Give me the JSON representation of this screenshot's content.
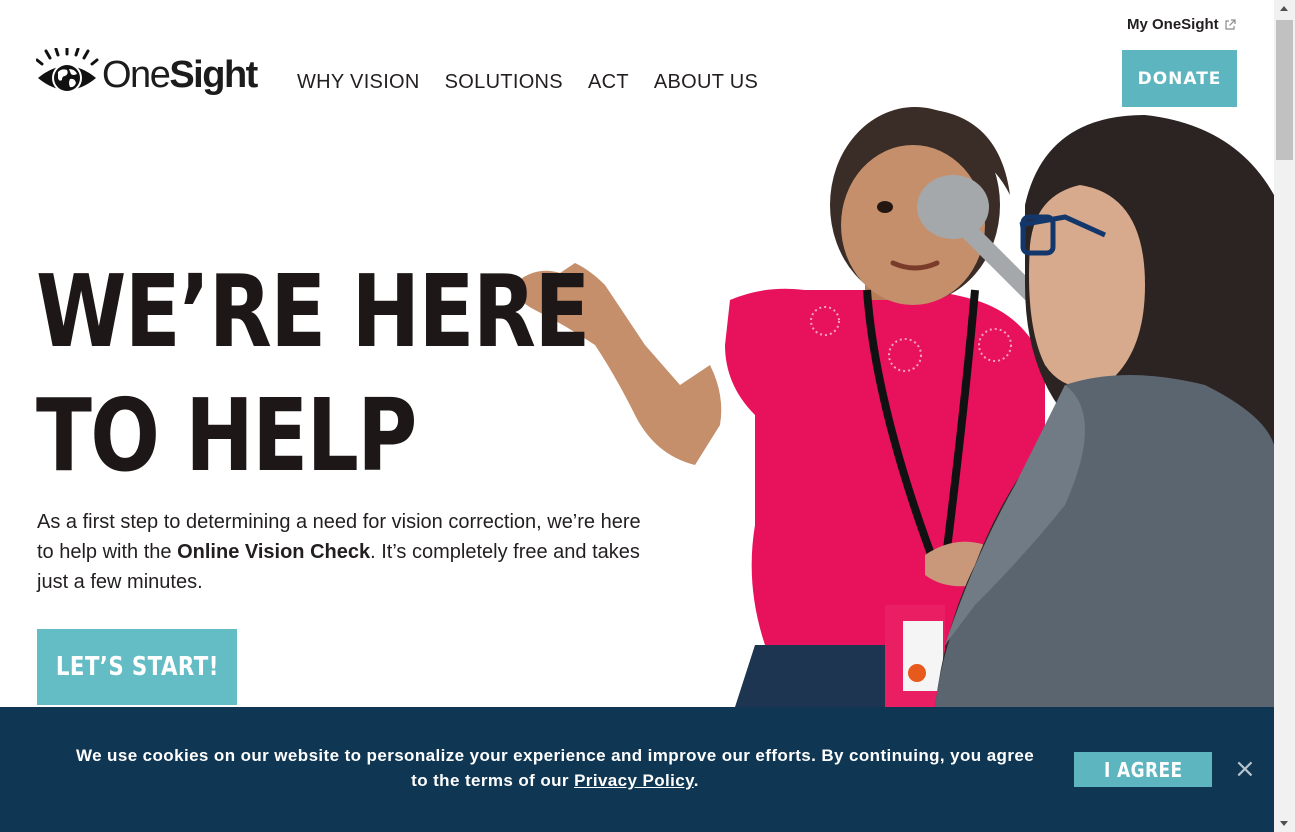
{
  "header": {
    "my_onesight": "My OneSight",
    "logo_text_light": "One",
    "logo_text_bold": "Sight",
    "nav": [
      "WHY VISION",
      "SOLUTIONS",
      "ACT",
      "ABOUT US"
    ],
    "donate": "DONATE"
  },
  "hero": {
    "title_line1": "WE’RE HERE",
    "title_line2": "TO HELP",
    "text_before": "As a first step to determining a need for vision correction, we’re here to help with the ",
    "text_bold": "Online Vision Check",
    "text_after": ". It’s completely free and takes just a few minutes.",
    "cta": "LET’S START!"
  },
  "cookie": {
    "text_before": "We use cookies on our website to personalize your experience and improve our efforts. By continuing, you agree to the terms of our ",
    "link": "Privacy Policy",
    "text_after": ".",
    "agree": "I AGREE",
    "close": "×"
  },
  "icons": {
    "logo": "globe-eye-logo-icon",
    "external": "external-link-icon",
    "close": "close-icon"
  },
  "colors": {
    "accent": "#5db6bf",
    "cookie_bg": "#0f3652",
    "text": "#231f20"
  }
}
